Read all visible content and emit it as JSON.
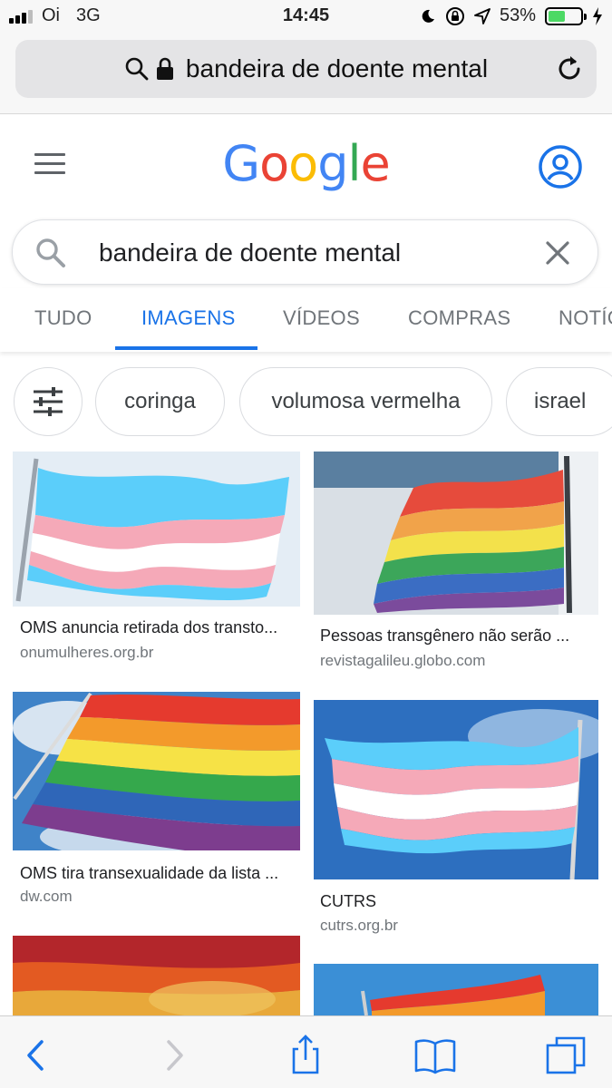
{
  "status": {
    "carrier": "Oi",
    "network": "3G",
    "time": "14:45",
    "battery_percent": "53%",
    "battery_level": 0.53,
    "colors": {
      "battery_fill": "#4cd964"
    }
  },
  "browser": {
    "url_text": "bandeira de doente mental",
    "icons": [
      "search-icon",
      "lock-icon",
      "reload-icon"
    ]
  },
  "google": {
    "logo_letters": [
      {
        "char": "G",
        "color": "#4285F4"
      },
      {
        "char": "o",
        "color": "#EA4335"
      },
      {
        "char": "o",
        "color": "#FBBC05"
      },
      {
        "char": "g",
        "color": "#4285F4"
      },
      {
        "char": "l",
        "color": "#34A853"
      },
      {
        "char": "e",
        "color": "#EA4335"
      }
    ],
    "search_query": "bandeira de doente mental"
  },
  "tabs": [
    {
      "label": "TUDO",
      "active": false
    },
    {
      "label": "IMAGENS",
      "active": true
    },
    {
      "label": "VÍDEOS",
      "active": false
    },
    {
      "label": "COMPRAS",
      "active": false
    },
    {
      "label": "NOTÍC",
      "active": false
    }
  ],
  "chips": [
    "coringa",
    "volumosa vermelha",
    "israel"
  ],
  "results": [
    {
      "title": "OMS anuncia retirada dos transto...",
      "source": "onumulheres.org.br",
      "flag": "trans-flag",
      "sky": "#dfe9f3"
    },
    {
      "title": "Pessoas transgênero não serão ...",
      "source": "revistagalileu.globo.com",
      "flag": "rainbow-flag",
      "sky": "#c9d8e4"
    },
    {
      "title": "OMS tira transexualidade da lista ...",
      "source": "dw.com",
      "flag": "rainbow-flag",
      "sky": "#3f83c8"
    },
    {
      "title": "CUTRS",
      "source": "cutrs.org.br",
      "flag": "trans-flag",
      "sky": "#2d6fbf"
    },
    {
      "title": "",
      "source": "",
      "flag": "rainbow-closeup",
      "sky": "#b3262b"
    },
    {
      "title": "",
      "source": "",
      "flag": "rainbow-flag",
      "sky": "#3b8fd6"
    }
  ],
  "toolbar": {
    "icons": [
      "back-icon",
      "forward-icon",
      "share-icon",
      "bookmarks-icon",
      "tabs-icon"
    ]
  }
}
